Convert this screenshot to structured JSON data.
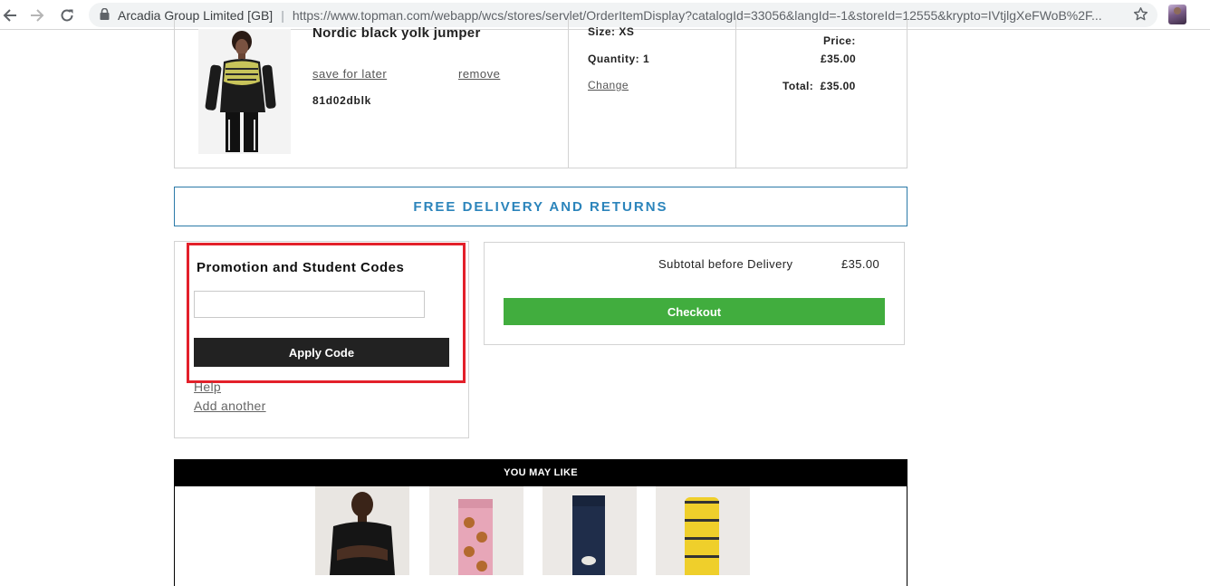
{
  "browser": {
    "site_label": "Arcadia Group Limited [GB]",
    "separator": "|",
    "url": "https://www.topman.com/webapp/wcs/stores/servlet/OrderItemDisplay?catalogId=33056&langId=-1&storeId=12555&krypto=IVtjlgXeFWoB%2F..."
  },
  "item": {
    "name": "Nordic black yolk jumper",
    "save_for_later": "save for later",
    "remove": "remove",
    "code": "81d02dblk",
    "size": "Size: XS",
    "quantity": "Quantity: 1",
    "change": "Change",
    "price_label": "Price:",
    "price_value": "£35.00",
    "total_label": "Total:",
    "total_value": "£35.00"
  },
  "delivery_banner": "FREE DELIVERY AND RETURNS",
  "promo": {
    "title": "Promotion and Student Codes",
    "input_value": "",
    "apply_label": "Apply Code",
    "help_label": "Help",
    "add_another_label": "Add another"
  },
  "summary": {
    "subtotal_label": "Subtotal before Delivery",
    "subtotal_value": "£35.00",
    "checkout_label": "Checkout"
  },
  "recommendations": {
    "title": "YOU MAY LIKE"
  },
  "colors": {
    "delivery_accent": "#2b84bb",
    "checkout_green": "#41ad3e",
    "highlight_red": "#e3202a"
  }
}
